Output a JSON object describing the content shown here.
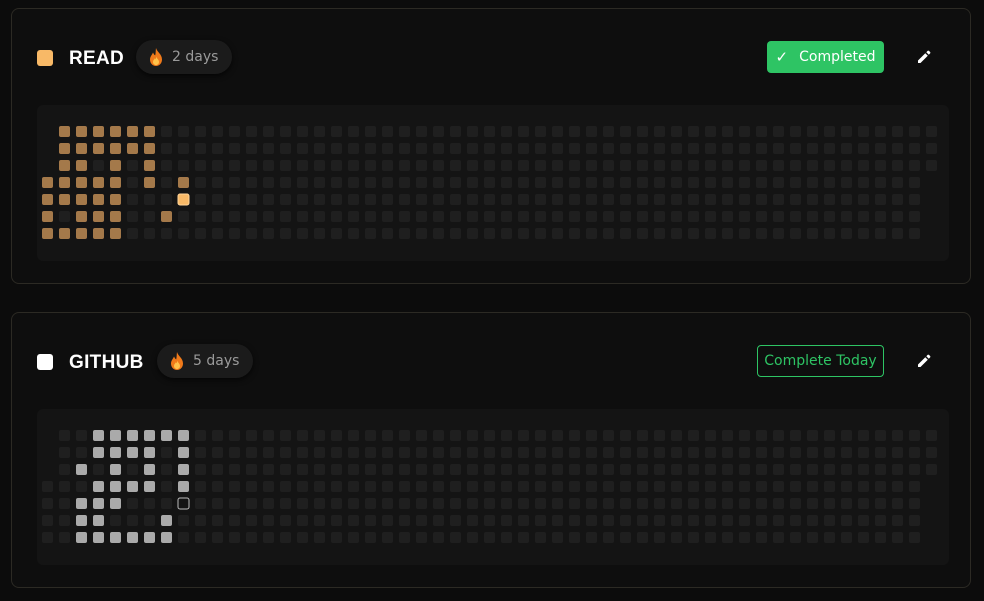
{
  "habits": [
    {
      "name": "READ",
      "color": "#f8b967",
      "streak_text": "2 days",
      "action_label": "Completed",
      "completed": true,
      "active_color": "#a4794a",
      "today_color": "#f8b967",
      "icons": {
        "streak": "fire-icon",
        "check": "check-icon",
        "edit": "pencil-icon"
      },
      "grid": {
        "weeks": 53,
        "today": [
          8,
          4
        ],
        "filled": [
          [
            0,
            3
          ],
          [
            0,
            4
          ],
          [
            0,
            5
          ],
          [
            0,
            6
          ],
          [
            1,
            0
          ],
          [
            1,
            1
          ],
          [
            1,
            2
          ],
          [
            1,
            3
          ],
          [
            1,
            4
          ],
          [
            1,
            6
          ],
          [
            2,
            0
          ],
          [
            2,
            1
          ],
          [
            2,
            2
          ],
          [
            2,
            3
          ],
          [
            2,
            4
          ],
          [
            2,
            5
          ],
          [
            2,
            6
          ],
          [
            3,
            0
          ],
          [
            3,
            1
          ],
          [
            3,
            3
          ],
          [
            3,
            4
          ],
          [
            3,
            5
          ],
          [
            3,
            6
          ],
          [
            4,
            0
          ],
          [
            4,
            1
          ],
          [
            4,
            2
          ],
          [
            4,
            3
          ],
          [
            4,
            4
          ],
          [
            4,
            5
          ],
          [
            4,
            6
          ],
          [
            5,
            0
          ],
          [
            5,
            1
          ],
          [
            6,
            0
          ],
          [
            6,
            1
          ],
          [
            6,
            2
          ],
          [
            6,
            3
          ],
          [
            7,
            5
          ],
          [
            8,
            3
          ]
        ]
      }
    },
    {
      "name": "GITHUB",
      "color": "#ffffff",
      "streak_text": "5 days",
      "action_label": "Complete Today",
      "completed": false,
      "active_color": "#aaaaaa",
      "today_color": "#141414",
      "icons": {
        "streak": "fire-icon",
        "edit": "pencil-icon"
      },
      "grid": {
        "weeks": 53,
        "today": [
          8,
          4
        ],
        "filled": [
          [
            2,
            2
          ],
          [
            2,
            4
          ],
          [
            2,
            5
          ],
          [
            2,
            6
          ],
          [
            3,
            0
          ],
          [
            3,
            1
          ],
          [
            3,
            3
          ],
          [
            3,
            4
          ],
          [
            3,
            5
          ],
          [
            3,
            6
          ],
          [
            4,
            0
          ],
          [
            4,
            1
          ],
          [
            4,
            2
          ],
          [
            4,
            3
          ],
          [
            4,
            4
          ],
          [
            4,
            6
          ],
          [
            5,
            0
          ],
          [
            5,
            1
          ],
          [
            5,
            3
          ],
          [
            5,
            6
          ],
          [
            6,
            0
          ],
          [
            6,
            1
          ],
          [
            6,
            2
          ],
          [
            6,
            3
          ],
          [
            6,
            6
          ],
          [
            7,
            0
          ],
          [
            7,
            5
          ],
          [
            7,
            6
          ],
          [
            8,
            0
          ],
          [
            8,
            1
          ],
          [
            8,
            2
          ],
          [
            8,
            3
          ]
        ]
      }
    }
  ]
}
